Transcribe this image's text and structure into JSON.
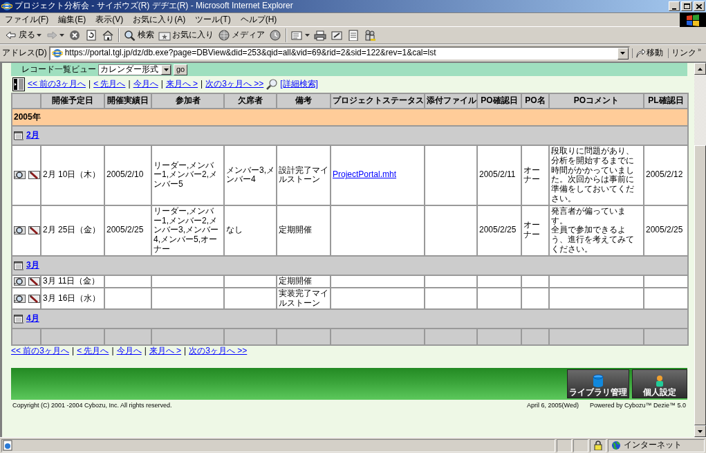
{
  "window": {
    "title": "プロジェクト分析会 - サイボウズ(R) デヂエ(R) - Microsoft Internet Explorer"
  },
  "menu": [
    "ファイル(F)",
    "編集(E)",
    "表示(V)",
    "お気に入り(A)",
    "ツール(T)",
    "ヘルプ(H)"
  ],
  "toolbar": {
    "groups": [
      [
        {
          "kind": "back",
          "label": "戻る",
          "dropdown": true
        },
        {
          "kind": "forward",
          "dropdown": true
        },
        {
          "kind": "stop"
        },
        {
          "kind": "refresh"
        },
        {
          "kind": "home"
        }
      ],
      [
        {
          "kind": "search",
          "label": "検索"
        },
        {
          "kind": "favorites",
          "label": "お気に入り"
        },
        {
          "kind": "media",
          "label": "メディア"
        },
        {
          "kind": "history"
        }
      ],
      [
        {
          "kind": "mail",
          "dropdown": true
        },
        {
          "kind": "print"
        },
        {
          "kind": "edit"
        },
        {
          "kind": "discuss"
        },
        {
          "kind": "messenger"
        }
      ]
    ]
  },
  "address": {
    "label": "アドレス(D)",
    "url": "https://portal.tgl.jp/dz/db.exe?page=DBView&did=253&qid=all&vid=69&rid=2&sid=122&rev=1&cal=lst",
    "go": "移動",
    "links": "リンク",
    "links_more": "»"
  },
  "view_bar": {
    "label": "レコード一覧ビュー",
    "select": "カレンダー形式",
    "button": "go"
  },
  "nav_top": {
    "links": [
      "<< 前の3ヶ月へ",
      "< 先月へ",
      "今月へ",
      "来月へ >",
      "次の3ヶ月へ >>"
    ],
    "separator": "|",
    "search": "[詳細検索]"
  },
  "table": {
    "columns": [
      "開催予定日",
      "開催実績日",
      "参加者",
      "欠席者",
      "備考",
      "プロジェクトステータス",
      "添付ファイル",
      "PO確認日",
      "PO名",
      "POコメント",
      "PL確認日"
    ],
    "year": "2005年",
    "months": [
      {
        "label": "2月",
        "rows": [
          {
            "scheduled_date": "2月 10日（木）",
            "actual_date": "2005/2/10",
            "participants": "リーダー,メンバー1,メンバー2,メンバー5",
            "absentees": "メンバー3,メンバー4",
            "remarks": "設計完了マイルストーン",
            "project_status": "ProjectPortal.mht",
            "po_date": "2005/2/11",
            "po_name": "オーナー",
            "po_comment": [
              "段取りに問題があり、分析を開始するまでに時間がかかっていました。次回からは事前に準備をしておいてください。"
            ],
            "pl_date": "2005/2/12"
          },
          {
            "scheduled_date": "2月 25日（金）",
            "actual_date": "2005/2/25",
            "participants": "リーダー,メンバー1,メンバー2,メンバー3,メンバー4,メンバー5,オーナー",
            "absentees": "なし",
            "remarks": "定期開催",
            "po_date": "2005/2/25",
            "po_name": "オーナー",
            "po_comment": [
              "発言者が偏っています。",
              "全員で参加できるよう、進行を考えてみてください。"
            ],
            "pl_date": "2005/2/25"
          }
        ]
      },
      {
        "label": "3月",
        "rows": [
          {
            "scheduled_date": "3月 11日（金）",
            "remarks": "定期開催"
          },
          {
            "scheduled_date": "3月 16日（水）",
            "remarks": "実装完了マイルストーン"
          }
        ]
      },
      {
        "label": "4月"
      }
    ]
  },
  "nav_bottom": {
    "links": [
      "<< 前の3ヶ月へ",
      "< 先月へ",
      "今月へ",
      "来月へ >",
      "次の3ヶ月へ >>"
    ],
    "separator": "|"
  },
  "footer_buttons": [
    "ライブラリ管理",
    "個人設定"
  ],
  "copyright": "Copyright (C) 2001 -2004 Cybozu, Inc. All rights reserved.",
  "date": "April 6, 2005(Wed)",
  "powered": "Powered by Cybozu™ Dezie™ 5.0",
  "status_bar": {
    "zone": "インターネット"
  }
}
